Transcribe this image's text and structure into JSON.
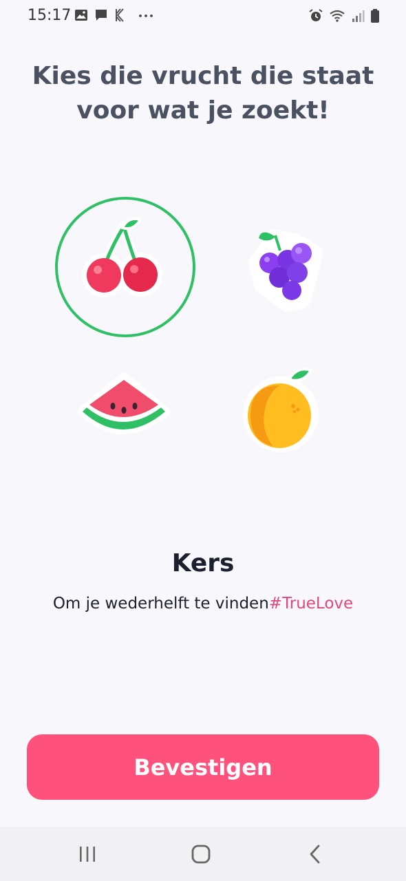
{
  "status_bar": {
    "time": "15:17",
    "left_icons": [
      "image-icon",
      "message-icon",
      "app-k-icon",
      "more-dots-icon"
    ],
    "right_icons": [
      "alarm-icon",
      "wifi-icon",
      "signal-icon",
      "battery-icon"
    ]
  },
  "title": "Kies die vrucht die staat voor wat je zoekt!",
  "fruits": [
    {
      "id": "cherry",
      "icon": "cherry-icon",
      "selected": true
    },
    {
      "id": "grapes",
      "icon": "grapes-icon",
      "selected": false
    },
    {
      "id": "watermelon",
      "icon": "watermelon-icon",
      "selected": false
    },
    {
      "id": "peach",
      "icon": "peach-icon",
      "selected": false
    }
  ],
  "selection": {
    "name": "Kers",
    "description": "Om je wederhelft te vinden",
    "hashtag": "#TrueLove"
  },
  "confirm_label": "Bevestigen",
  "colors": {
    "accent": "#fe527c",
    "selected_ring": "#2fbf64",
    "hashtag": "#e2487d",
    "title": "#4a5160"
  },
  "nav": {
    "icons": [
      "recent-apps-icon",
      "home-icon",
      "back-icon"
    ]
  }
}
